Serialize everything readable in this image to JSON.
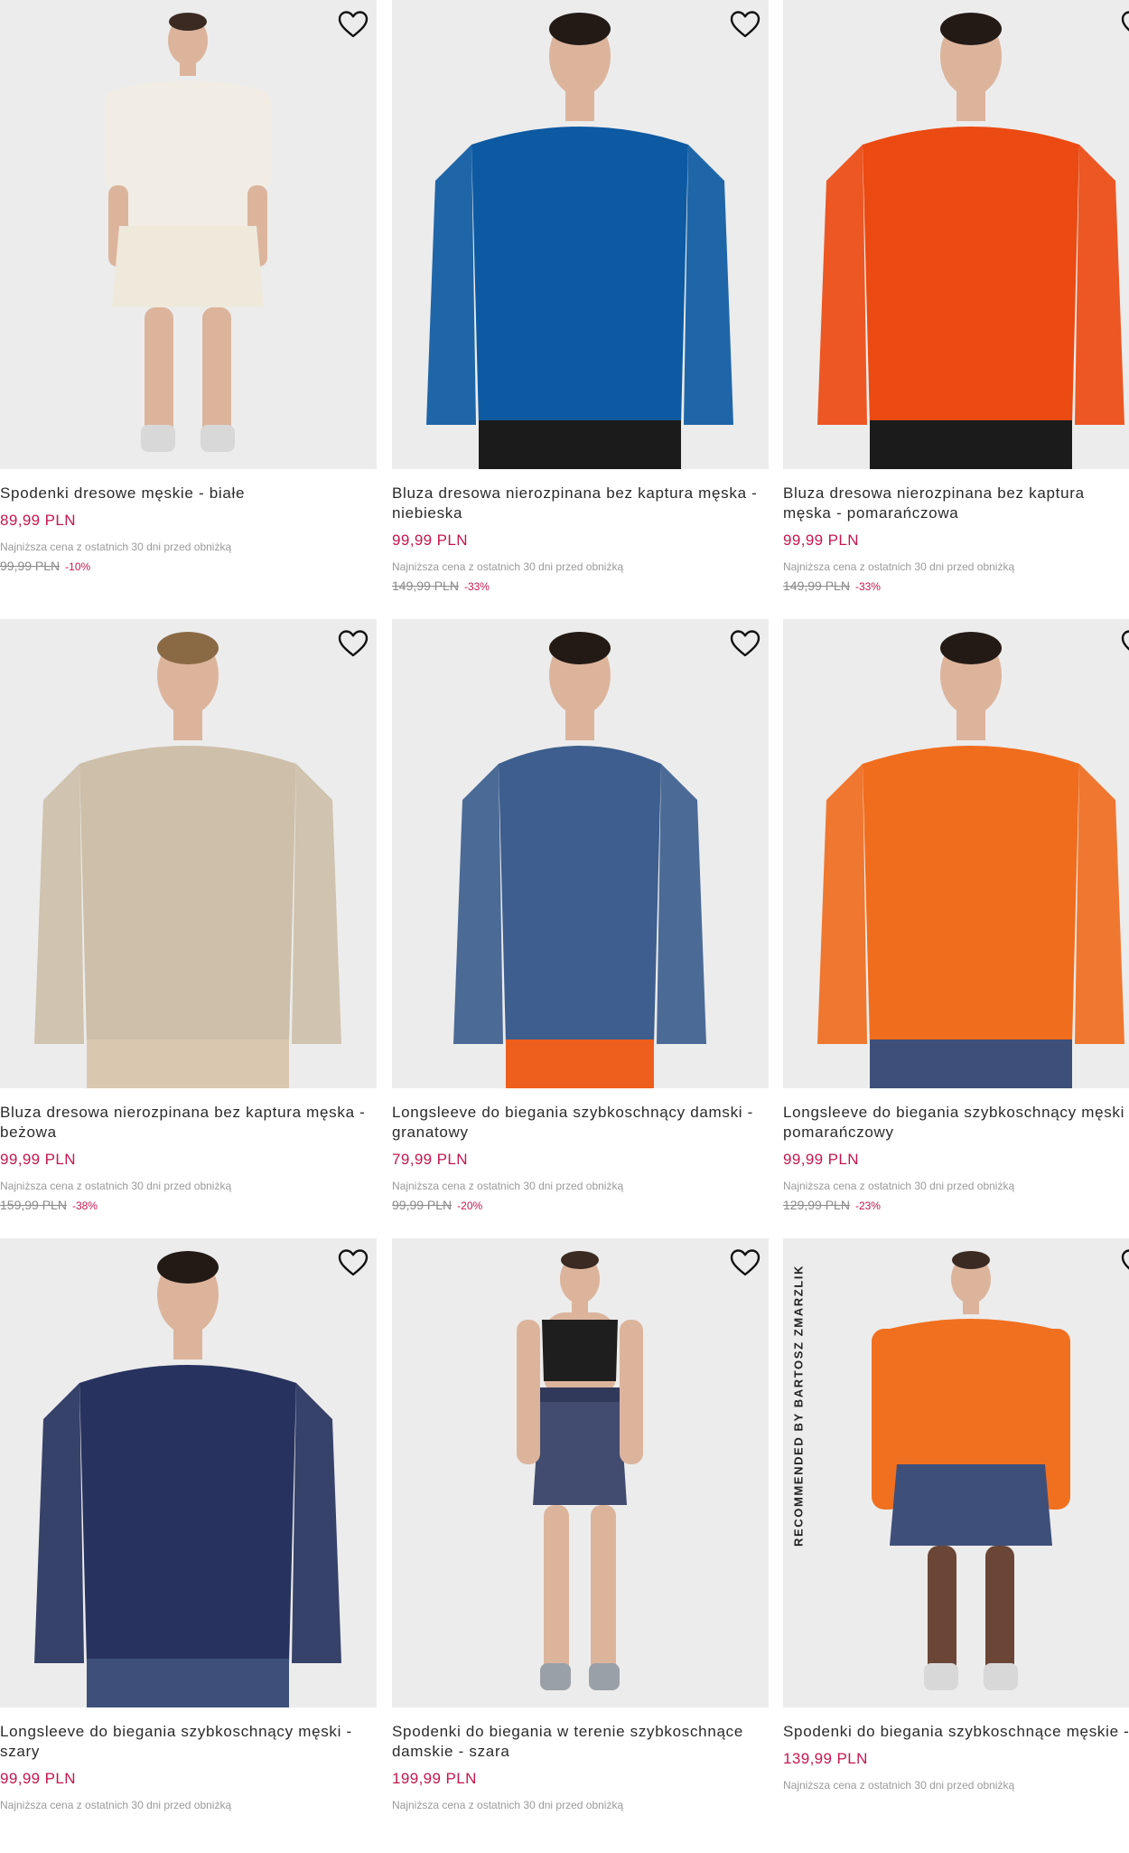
{
  "colors": {
    "price": "#c4174f",
    "photo_bg": "#ececec"
  },
  "wishlist_icon": "heart-outline-icon",
  "products": [
    {
      "name": "Spodenki dresowe męskie - białe",
      "price": "89,99 PLN",
      "lowest_note": "Najniższa cena z ostatnich 30 dni przed obniżką",
      "old_price": "99,99 PLN",
      "discount": "-10%",
      "garment_color": "#f1ede4",
      "bottom_color": "#efe9dc"
    },
    {
      "name": "Bluza dresowa nierozpinana bez kaptura męska - niebieska",
      "price": "99,99 PLN",
      "lowest_note": "Najniższa cena z ostatnich 30 dni przed obniżką",
      "old_price": "149,99 PLN",
      "discount": "-33%",
      "garment_color": "#0d5aa2",
      "bottom_color": "#1b1b1b"
    },
    {
      "name": "Bluza dresowa nierozpinana bez kaptura męska - pomarańczowa",
      "price": "99,99 PLN",
      "lowest_note": "Najniższa cena z ostatnich 30 dni przed obniżką",
      "old_price": "149,99 PLN",
      "discount": "-33%",
      "garment_color": "#eb4a12",
      "bottom_color": "#1b1b1b"
    },
    {
      "name": "Bluza dresowa nierozpinana bez kaptura męska - beżowa",
      "price": "99,99 PLN",
      "lowest_note": "Najniższa cena z ostatnich 30 dni przed obniżką",
      "old_price": "159,99 PLN",
      "discount": "-38%",
      "garment_color": "#cdbfa9",
      "bottom_color": "#d9c7b0"
    },
    {
      "name": "Longsleeve do biegania szybkoschnący damski - granatowy",
      "price": "79,99 PLN",
      "lowest_note": "Najniższa cena z ostatnich 30 dni przed obniżką",
      "old_price": "99,99 PLN",
      "discount": "-20%",
      "garment_color": "#3d5e8e",
      "bottom_color": "#ee5e1c"
    },
    {
      "name": "Longsleeve do biegania szybkoschnący męski - pomarańczowy",
      "price": "99,99 PLN",
      "lowest_note": "Najniższa cena z ostatnich 30 dni przed obniżką",
      "old_price": "129,99 PLN",
      "discount": "-23%",
      "garment_color": "#f06d1e",
      "bottom_color": "#3e4f7a"
    },
    {
      "name": "Longsleeve do biegania szybkoschnący męski - szary",
      "price": "99,99 PLN",
      "lowest_note": "Najniższa cena z ostatnich 30 dni przed obniżką",
      "old_price": "",
      "discount": "",
      "garment_color": "#27335e",
      "bottom_color": "#3e4f7a"
    },
    {
      "name": "Spodenki do biegania w terenie szybkoschnące damskie - szara",
      "price": "199,99 PLN",
      "lowest_note": "Najniższa cena z ostatnich 30 dni przed obniżką",
      "old_price": "",
      "discount": "",
      "garment_color": "#1e1e1e",
      "bottom_color": "#424c70"
    },
    {
      "name": "Spodenki do biegania szybkoschnące męskie - szare",
      "price": "139,99 PLN",
      "lowest_note": "Najniższa cena z ostatnich 30 dni przed obniżką",
      "old_price": "",
      "discount": "",
      "garment_color": "#f07020",
      "bottom_color": "#3e4f7a",
      "vertical_label": "RECOMMENDED BY BARTOSZ ZMARZLIK"
    }
  ]
}
